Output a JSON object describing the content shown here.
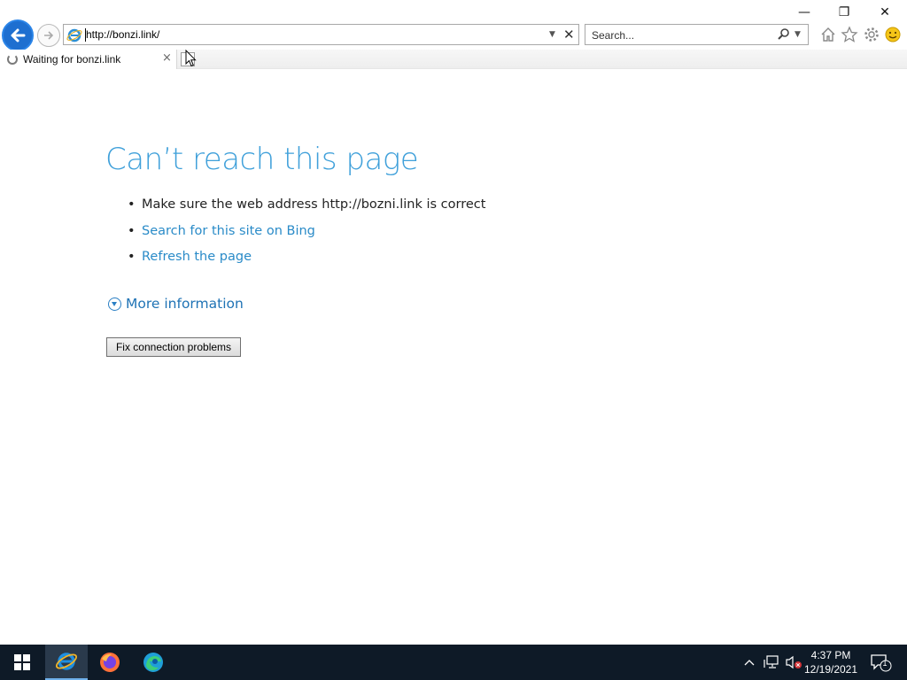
{
  "browser": {
    "address": {
      "url": "http://bonzi.link/"
    },
    "search": {
      "placeholder": "Search..."
    },
    "tab": {
      "title": "Waiting for bonzi.link",
      "close_glyph": "×"
    },
    "window_controls": {
      "minimize": "—",
      "restore": "❐",
      "close": "✕"
    }
  },
  "page": {
    "heading": "Can’t reach this page",
    "bullets": [
      {
        "text": "Make sure the web address http://bozni.link is correct",
        "link": false
      },
      {
        "text": "Search for this site on Bing",
        "link": true
      },
      {
        "text": "Refresh the page",
        "link": true
      }
    ],
    "more_info": "More information",
    "fix_button": "Fix connection problems"
  },
  "taskbar": {
    "time": "4:37 PM",
    "date": "12/19/2021",
    "notification_count": "1",
    "apps": [
      "internet-explorer-icon",
      "firefox-icon",
      "edge-icon"
    ]
  },
  "colors": {
    "heading": "#3fa0da",
    "link": "#2a8bc8",
    "taskbar": "#0e1a27",
    "back_button": "#1e6fd0"
  }
}
